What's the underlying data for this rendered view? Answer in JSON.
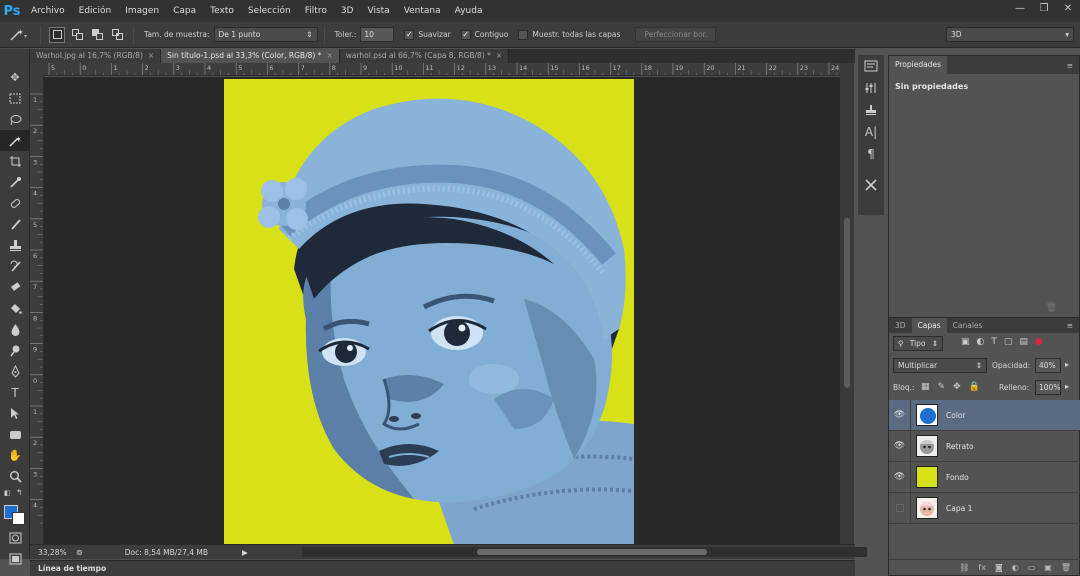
{
  "app": {
    "logo": "Ps"
  },
  "menu": [
    "Archivo",
    "Edición",
    "Imagen",
    "Capa",
    "Texto",
    "Selección",
    "Filtro",
    "3D",
    "Vista",
    "Ventana",
    "Ayuda"
  ],
  "window_controls": {
    "minimize": "—",
    "restore": "❐",
    "close": "✕"
  },
  "options": {
    "sample_size_label": "Tam. de muestra:",
    "sample_size_value": "De 1 punto",
    "tolerance_label": "Toler.:",
    "tolerance_value": "10",
    "smooth_label": "Suavizar",
    "contiguous_label": "Contiguo",
    "sample_all_label": "Muestr. todas las capas",
    "refine_edge_label": "Perfeccionar bor.",
    "workspace_value": "3D"
  },
  "tabs": [
    {
      "label": "Warhol.jpg al 16,7% (RGB/8)",
      "close": "×"
    },
    {
      "label": "Sin título-1.psd al 33,3% (Color, RGB/8) *",
      "close": "×"
    },
    {
      "label": "warhol.psd al 66,7% (Capa 8, RGB/8) *",
      "close": "×"
    }
  ],
  "ruler_top_labels": [
    "5",
    "0",
    "1",
    "2",
    "3",
    "4",
    "5",
    "6",
    "7",
    "8",
    "9",
    "10",
    "11",
    "12",
    "13",
    "14",
    "15",
    "16",
    "17",
    "18",
    "19",
    "20",
    "21",
    "22",
    "23",
    "24"
  ],
  "ruler_left_labels": [
    "1",
    "2",
    "3",
    "4",
    "5",
    "6",
    "7",
    "8",
    "9",
    "0",
    "1",
    "2",
    "3",
    "4"
  ],
  "status": {
    "zoom": "33,28%",
    "doc_info": "Doc: 8,54 MB/27,4 MB"
  },
  "timeline": {
    "label": "Línea de tiempo"
  },
  "properties_panel": {
    "title": "Propiedades",
    "content": "Sin propiedades"
  },
  "layers_panel": {
    "tabs": [
      "3D",
      "Capas",
      "Canales"
    ],
    "filter_label": "Tipo",
    "blend_mode": "Multiplicar",
    "opacity_label": "Opacidad:",
    "opacity_value": "40%",
    "lock_label": "Bloq.:",
    "fill_label": "Relleno:",
    "fill_value": "100%",
    "layers": [
      {
        "name": "Color",
        "visible": true,
        "selected": true
      },
      {
        "name": "Retrato",
        "visible": true,
        "selected": false
      },
      {
        "name": "Fondo",
        "visible": true,
        "selected": false
      },
      {
        "name": "Capa 1",
        "visible": false,
        "selected": false
      }
    ]
  },
  "colors": {
    "canvas_bg": "#d8e017",
    "baby_light": "#82aed6",
    "baby_mid": "#5b7fa6",
    "baby_dark": "#1e2a3a",
    "foreground_color": "#1b6fd0",
    "layer_color_swatch": "#1b6fd0",
    "layer_fondo_swatch": "#d8e017"
  }
}
